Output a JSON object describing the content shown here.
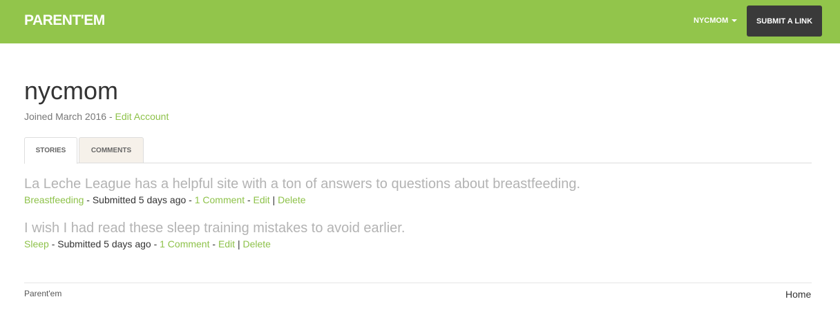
{
  "navbar": {
    "brand": "PARENT'EM",
    "user_menu_label": "NYCMOM",
    "submit_label": "SUBMIT A LINK",
    "bg_color": "#92c54b"
  },
  "profile": {
    "username": "nycmom",
    "joined": "Joined March 2016",
    "separator": " - ",
    "edit_account": "Edit Account"
  },
  "tabs": [
    {
      "label": "STORIES",
      "active": true
    },
    {
      "label": "COMMENTS",
      "active": false
    }
  ],
  "stories": [
    {
      "title": "La Leche League has a helpful site with a ton of answers to questions about breastfeeding.",
      "category": "Breastfeeding",
      "submitted": " - Submitted 5 days ago - ",
      "comments": "1 Comment",
      "sep1": " - ",
      "edit": "Edit",
      "sep2": " | ",
      "delete": "Delete"
    },
    {
      "title": "I wish I had read these sleep training mistakes to avoid earlier.",
      "category": "Sleep",
      "submitted": " - Submitted 5 days ago - ",
      "comments": "1 Comment",
      "sep1": " - ",
      "edit": "Edit",
      "sep2": " | ",
      "delete": "Delete"
    }
  ],
  "footer": {
    "brand": "Parent'em",
    "home": "Home"
  }
}
